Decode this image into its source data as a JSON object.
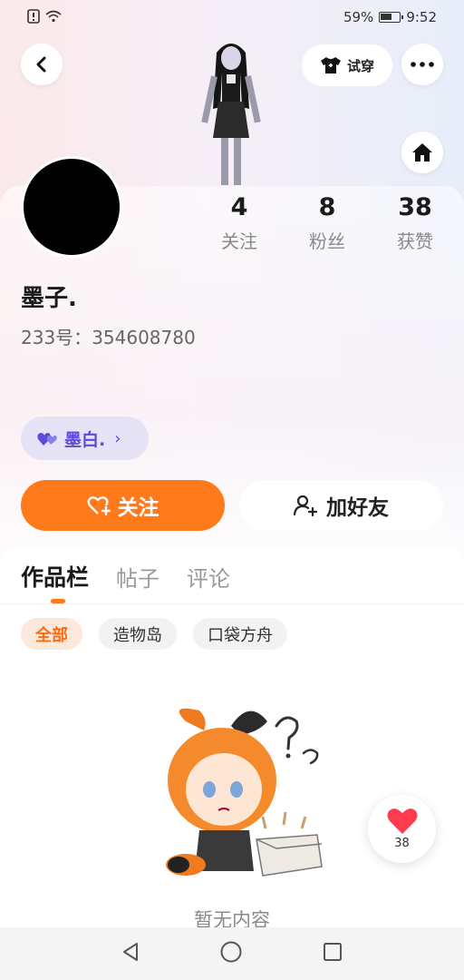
{
  "status_bar": {
    "battery": "59%",
    "time": "9:52"
  },
  "header": {
    "try_on_label": "试穿"
  },
  "profile": {
    "nickname": "墨子.",
    "uid_label": "233号：",
    "uid": "354608780"
  },
  "stats": [
    {
      "value": "4",
      "label": "关注"
    },
    {
      "value": "8",
      "label": "粉丝"
    },
    {
      "value": "38",
      "label": "获赞"
    }
  ],
  "guild": {
    "label": "墨白."
  },
  "actions": {
    "follow_label": "关注",
    "add_friend_label": "加好友"
  },
  "tabs": [
    {
      "label": "作品栏",
      "active": true
    },
    {
      "label": "帖子",
      "active": false
    },
    {
      "label": "评论",
      "active": false
    }
  ],
  "chips": [
    {
      "label": "全部",
      "active": true
    },
    {
      "label": "造物岛",
      "active": false
    },
    {
      "label": "口袋方舟",
      "active": false
    }
  ],
  "empty_state": {
    "text": "暂无内容"
  },
  "like_fab": {
    "count": "38"
  },
  "colors": {
    "accent": "#ff7a1a",
    "guild_bg": "#e6e3f6",
    "guild_text": "#5b4bd6",
    "heart": "#ff3b4e"
  }
}
